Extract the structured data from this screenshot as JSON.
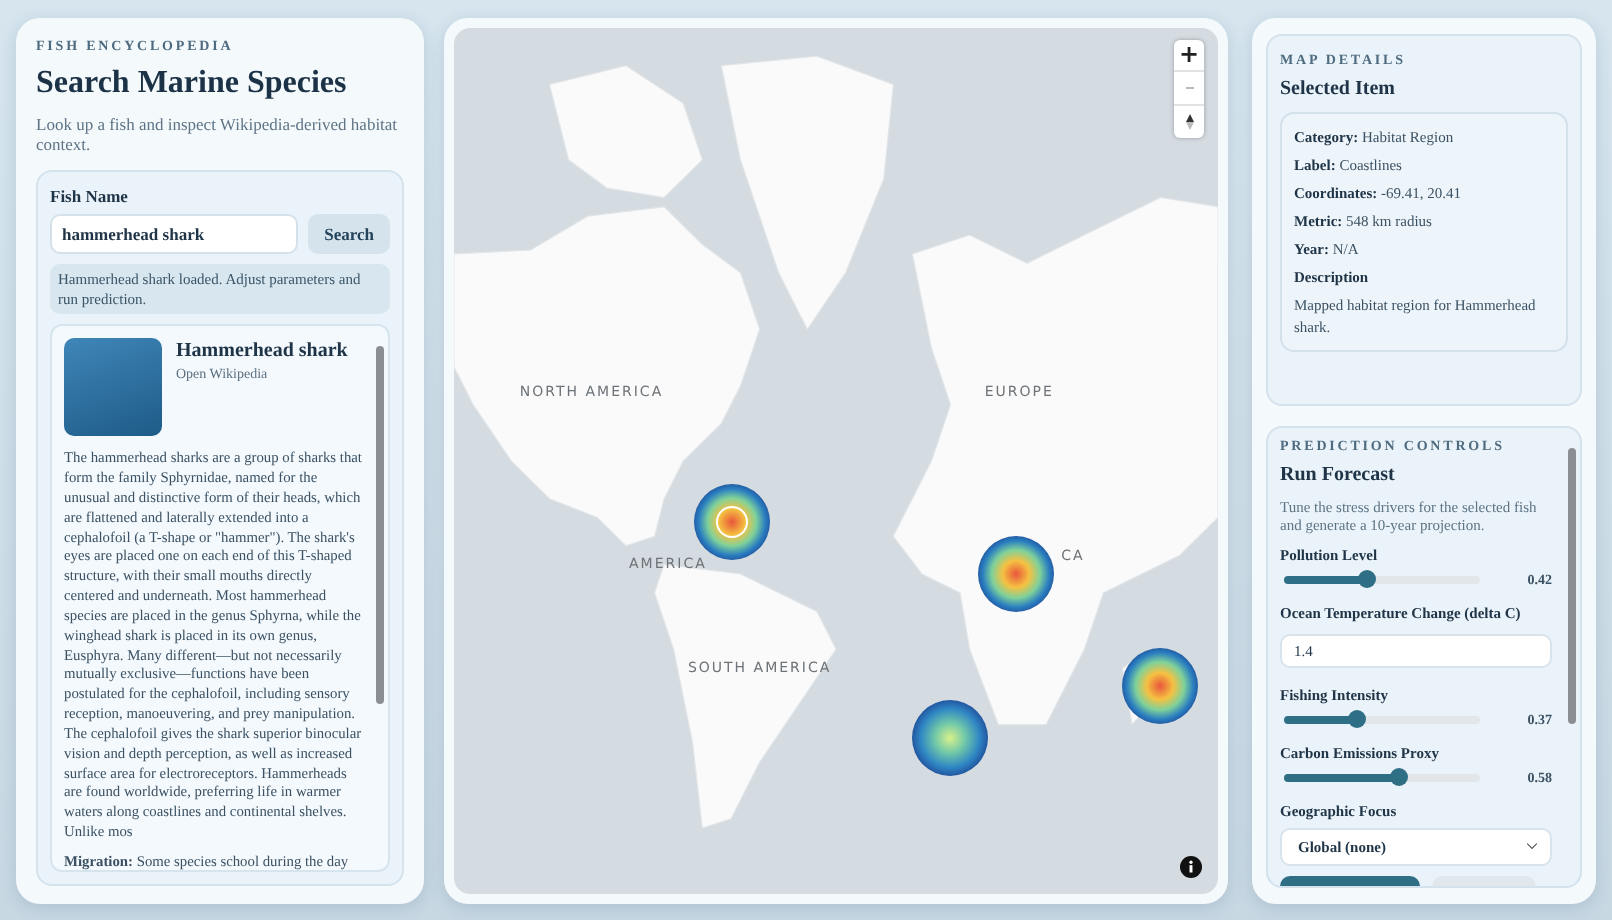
{
  "search_panel": {
    "eyebrow": "FISH ENCYCLOPEDIA",
    "title": "Search Marine Species",
    "subtitle": "Look up a fish and inspect Wikipedia-derived habitat context.",
    "field_label": "Fish Name",
    "query": "hammerhead shark",
    "search_button": "Search",
    "status": "Hammerhead shark loaded. Adjust parameters and run prediction.",
    "species": {
      "name": "Hammerhead shark",
      "link": "Open Wikipedia",
      "summary": "The hammerhead sharks are a group of sharks that form the family Sphyrnidae, named for the unusual and distinctive form of their heads, which are flattened and laterally extended into a cephalofoil (a T-shape or \"hammer\"). The shark's eyes are placed one on each end of this T-shaped structure, with their small mouths directly centered and underneath. Most hammerhead species are placed in the genus Sphyrna, while the winghead shark is placed in its own genus, Eusphyra. Many different—but not necessarily mutually exclusive—functions have been postulated for the cephalofoil, including sensory reception, manoeuvering, and prey manipulation. The cephalofoil gives the shark superior binocular vision and depth perception, as well as increased surface area for electroreceptors. Hammerheads are found worldwide, preferring life in warmer waters along coastlines and continental shelves. Unlike mos",
      "migration": "**Migration:** Some species school during the day"
    }
  },
  "map": {
    "labels": [
      "NORTH AMERICA",
      "EUROPE",
      "AMERICA",
      "CA",
      "SOUTH AMERICA"
    ],
    "heat_spots": [
      {
        "kind": "hot",
        "selected": true
      },
      {
        "kind": "hot",
        "selected": false
      },
      {
        "kind": "hot",
        "selected": false
      },
      {
        "kind": "cool",
        "selected": false
      }
    ],
    "zoom_in": "+"
  },
  "map_details": {
    "eyebrow": "MAP DETAILS",
    "title": "Selected Item",
    "fields": [
      {
        "label": "Category:",
        "value": "Habitat Region"
      },
      {
        "label": "Label:",
        "value": "Coastlines"
      },
      {
        "label": "Coordinates:",
        "value": "-69.41, 20.41"
      },
      {
        "label": "Metric:",
        "value": "548 km radius"
      },
      {
        "label": "Year:",
        "value": "N/A"
      }
    ],
    "description_label": "Description",
    "description": "Mapped habitat region for Hammerhead shark."
  },
  "prediction_controls": {
    "eyebrow": "PREDICTION CONTROLS",
    "title": "Run Forecast",
    "intro": "Tune the stress drivers for the selected fish and generate a 10-year projection.",
    "controls": [
      {
        "kind": "slider",
        "label": "Pollution Level",
        "level": 0.42,
        "reading": "0.42"
      },
      {
        "kind": "number",
        "label": "Ocean Temperature Change (delta C)",
        "value": "1.4"
      },
      {
        "kind": "slider",
        "label": "Fishing Intensity",
        "level": 0.37,
        "reading": "0.37"
      },
      {
        "kind": "slider",
        "label": "Carbon Emissions Proxy",
        "level": 0.58,
        "reading": "0.58"
      },
      {
        "kind": "select",
        "label": "Geographic Focus",
        "value": "Global (none)"
      }
    ]
  }
}
